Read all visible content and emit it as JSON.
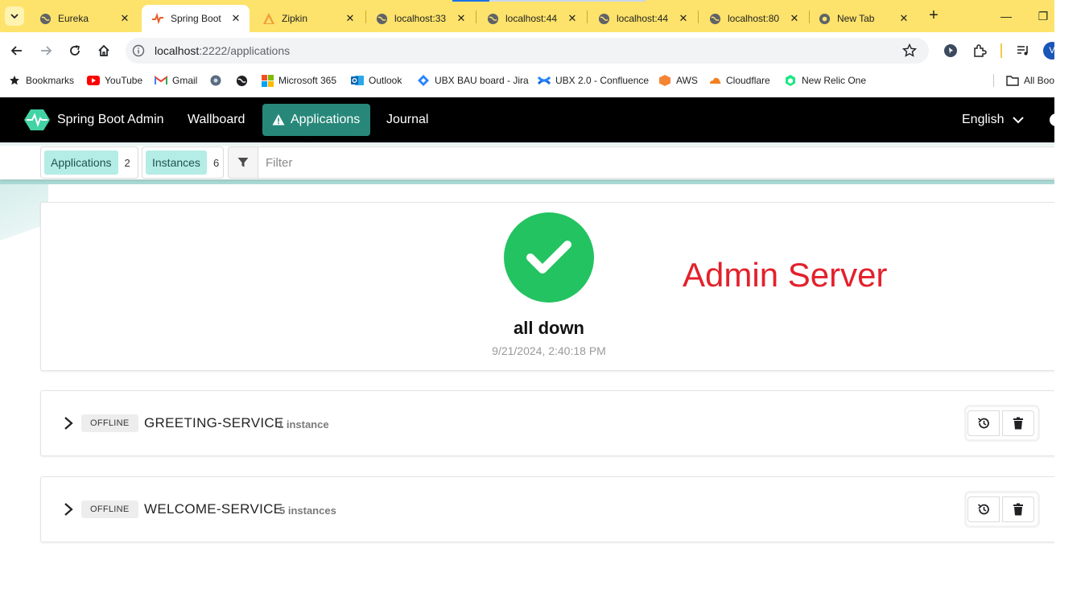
{
  "browser": {
    "tabs": [
      {
        "title": "Eureka",
        "icon": "globe-icon"
      },
      {
        "title": "Spring Boot",
        "icon": "spring-boot-admin-icon",
        "active": true
      },
      {
        "title": "Zipkin",
        "icon": "zipkin-icon"
      },
      {
        "title": "localhost:33",
        "icon": "globe-icon"
      },
      {
        "title": "localhost:44",
        "icon": "globe-icon"
      },
      {
        "title": "localhost:44",
        "icon": "globe-icon"
      },
      {
        "title": "localhost:80",
        "icon": "globe-icon"
      },
      {
        "title": "New Tab",
        "icon": "chrome-icon"
      }
    ],
    "url_host": "localhost",
    "url_rest": ":2222/applications",
    "profile_initial": "V",
    "bookmarks": [
      {
        "label": "Bookmarks",
        "icon": "star-icon"
      },
      {
        "label": "YouTube",
        "icon": "youtube-icon"
      },
      {
        "label": "Gmail",
        "icon": "gmail-icon"
      },
      {
        "label": "",
        "icon": "settings-globe-icon"
      },
      {
        "label": "",
        "icon": "globe-icon"
      },
      {
        "label": "Microsoft 365",
        "icon": "microsoft-icon"
      },
      {
        "label": "Outlook",
        "icon": "outlook-icon"
      },
      {
        "label": "UBX BAU board - Jira",
        "icon": "jira-icon"
      },
      {
        "label": "UBX 2.0 - Confluence",
        "icon": "confluence-icon"
      },
      {
        "label": "AWS",
        "icon": "aws-icon"
      },
      {
        "label": "Cloudflare",
        "icon": "cloudflare-icon"
      },
      {
        "label": "New Relic One",
        "icon": "new-relic-icon"
      },
      {
        "label": "All Boo",
        "icon": "folder-icon"
      }
    ]
  },
  "app": {
    "brand": "Spring Boot Admin",
    "nav": {
      "wallboard": "Wallboard",
      "applications": "Applications",
      "journal": "Journal"
    },
    "language": "English",
    "colors": {
      "header": "#000000",
      "active_nav": "#27887a",
      "ok": "#23c361",
      "tag": "#b4ece6",
      "annotation": "#e3212b"
    }
  },
  "filter": {
    "applications_label": "Applications",
    "applications_count": "2",
    "instances_label": "Instances",
    "instances_count": "6",
    "placeholder": "Filter"
  },
  "status": {
    "title": "all down",
    "timestamp": "9/21/2024, 2:40:18 PM",
    "annotation": "Admin Server"
  },
  "applications": [
    {
      "status": "OFFLINE",
      "name": "GREETING-SERVICE",
      "instances": "1 instance"
    },
    {
      "status": "OFFLINE",
      "name": "WELCOME-SERVICE",
      "instances": "5 instances"
    }
  ]
}
